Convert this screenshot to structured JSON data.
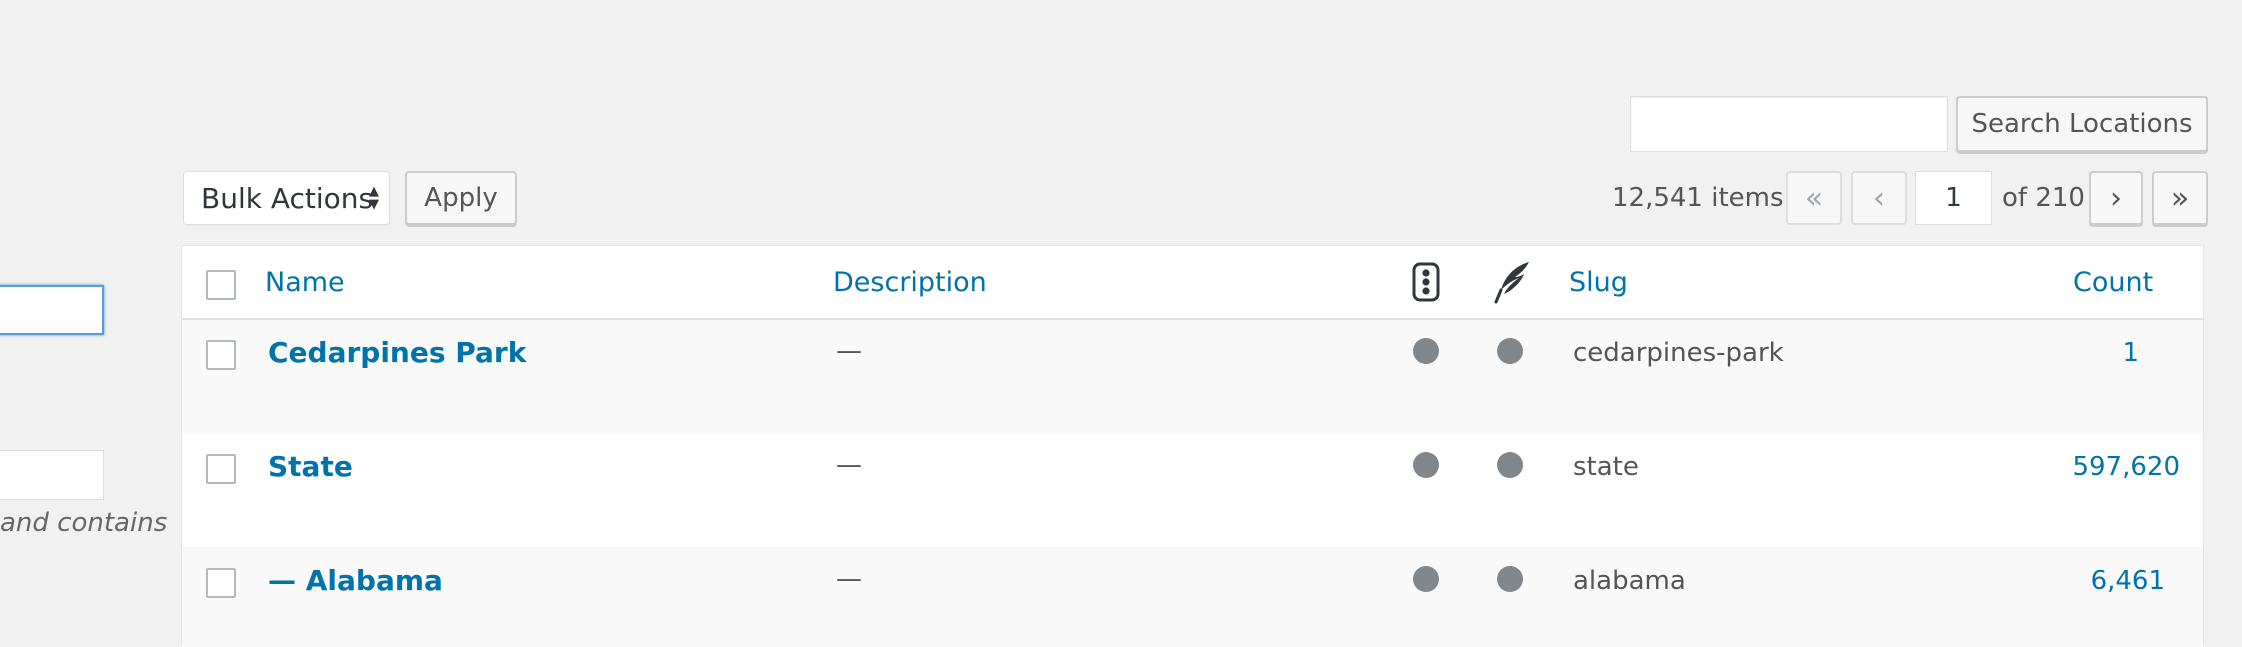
{
  "left_form": {
    "hint_text": "and contains"
  },
  "search": {
    "input_value": "",
    "button_label": "Search Locations"
  },
  "bulk": {
    "select_value": "Bulk Actions",
    "apply_label": "Apply"
  },
  "pagination": {
    "items_text": "12,541 items",
    "first_symbol": "«",
    "prev_symbol": "‹",
    "current_page": "1",
    "of_text": "of 210",
    "next_symbol": "›",
    "last_symbol": "»"
  },
  "table": {
    "columns": {
      "name": "Name",
      "description": "Description",
      "col3_icon": "traffic-light-icon",
      "col4_icon": "feather-icon",
      "slug": "Slug",
      "count": "Count"
    },
    "rows": [
      {
        "name": "Cedarpines Park",
        "description": "—",
        "slug": "cedarpines-park",
        "count": "1"
      },
      {
        "name": "State",
        "description": "—",
        "slug": "state",
        "count": "597,620"
      },
      {
        "name": "— Alabama",
        "description": "—",
        "slug": "alabama",
        "count": "6,461"
      }
    ]
  },
  "colors": {
    "link": "#0073aa",
    "background": "#f1f1f1",
    "status_dot": "#82878c"
  }
}
